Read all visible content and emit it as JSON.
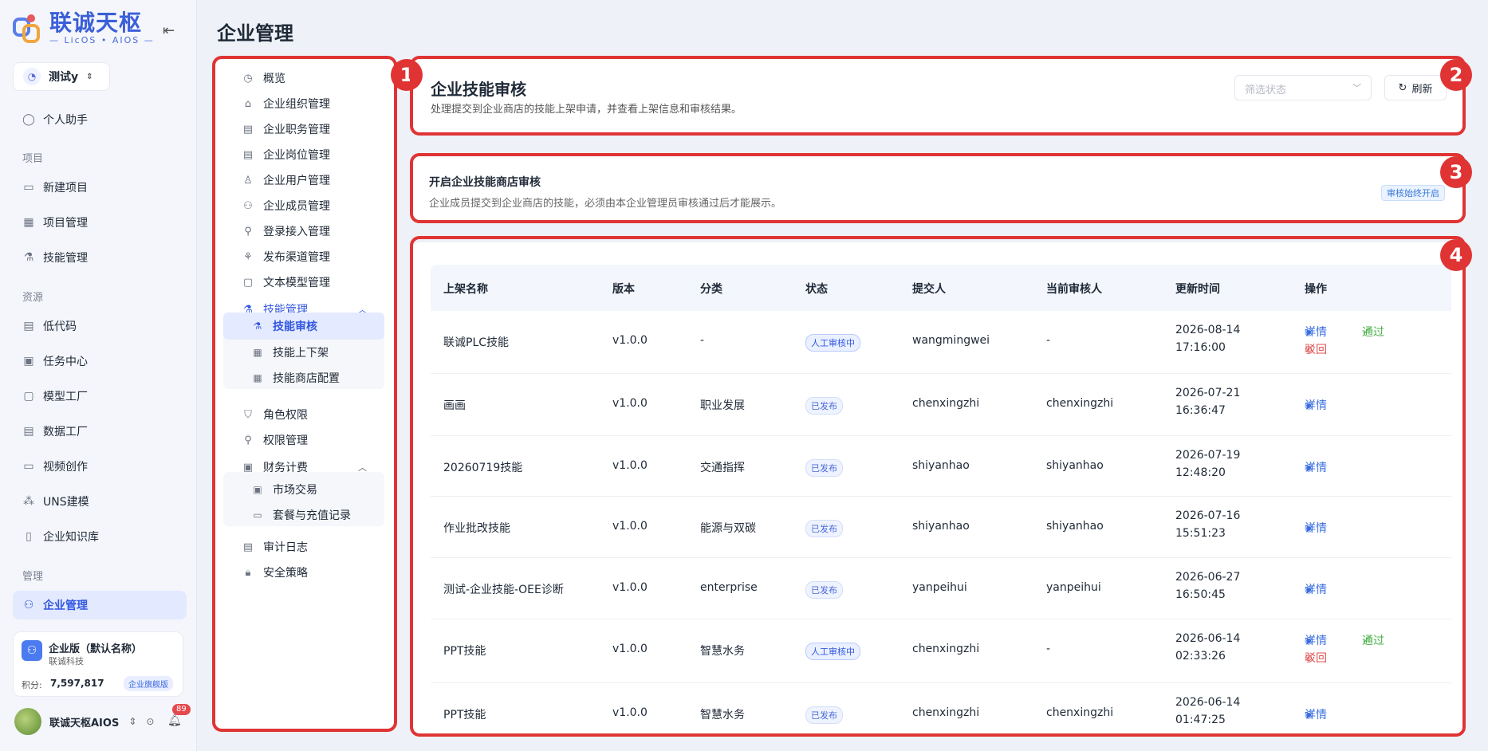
{
  "brand": {
    "title": "联诚天枢",
    "subtitle": "— LicOS • AIOS —"
  },
  "workspace": {
    "name": "测试y"
  },
  "app_nav": {
    "assistant": "个人助手",
    "group_project": "项目",
    "new_project": "新建项目",
    "project_mgmt": "项目管理",
    "skill_mgmt": "技能管理",
    "group_resource": "资源",
    "low_code": "低代码",
    "task_center": "任务中心",
    "model_factory": "模型工厂",
    "data_factory": "数据工厂",
    "video_create": "视频创作",
    "uns": "UNS建模",
    "knowledge": "企业知识库",
    "group_manage": "管理",
    "enterprise_mgmt": "企业管理"
  },
  "org_card": {
    "name": "企业版（默认名称）",
    "company": "联诚科技",
    "points_label": "积分:",
    "points_value": "7,597,817",
    "plan_badge": "企业旗舰版"
  },
  "user": {
    "name": "联诚天枢AIOS",
    "notifications": "89"
  },
  "page_title": "企业管理",
  "sub_menu": {
    "overview": "概览",
    "org": "企业组织管理",
    "duty": "企业职务管理",
    "post": "企业岗位管理",
    "user": "企业用户管理",
    "member": "企业成员管理",
    "login": "登录接入管理",
    "channel": "发布渠道管理",
    "text_model": "文本模型管理",
    "skill": "技能管理",
    "skill_review": "技能审核",
    "skill_shelf": "技能上下架",
    "skill_store": "技能商店配置",
    "role": "角色权限",
    "perm": "权限管理",
    "finance": "财务计费",
    "market": "市场交易",
    "package": "套餐与充值记录",
    "audit": "审计日志",
    "security": "安全策略"
  },
  "header_card": {
    "title": "企业技能审核",
    "desc": "处理提交到企业商店的技能上架申请，并查看上架信息和审核结果。",
    "filter_placeholder": "筛选状态",
    "refresh": "刷新"
  },
  "setting_card": {
    "title": "开启企业技能商店审核",
    "desc": "企业成员提交到企业商店的技能，必须由本企业管理员审核通过后才能展示。",
    "badge": "审核始终开启"
  },
  "table": {
    "columns": [
      "上架名称",
      "版本",
      "分类",
      "状态",
      "提交人",
      "当前审核人",
      "更新时间",
      "操作"
    ],
    "rows": [
      {
        "name": "联诚PLC技能",
        "version": "v1.0.0",
        "category": "-",
        "status": "人工审核中",
        "status_type": "review",
        "submitter": "wangmingwei",
        "reviewer": "-",
        "date": "2026-08-14",
        "time": "17:16:00",
        "actions": [
          "详情",
          "通过",
          "驳回"
        ]
      },
      {
        "name": "画画",
        "version": "v1.0.0",
        "category": "职业发展",
        "status": "已发布",
        "status_type": "pub",
        "submitter": "chenxingzhi",
        "reviewer": "chenxingzhi",
        "date": "2026-07-21",
        "time": "16:36:47",
        "actions": [
          "详情"
        ]
      },
      {
        "name": "20260719技能",
        "version": "v1.0.0",
        "category": "交通指挥",
        "status": "已发布",
        "status_type": "pub",
        "submitter": "shiyanhao",
        "reviewer": "shiyanhao",
        "date": "2026-07-19",
        "time": "12:48:20",
        "actions": [
          "详情"
        ]
      },
      {
        "name": "作业批改技能",
        "version": "v1.0.0",
        "category": "能源与双碳",
        "status": "已发布",
        "status_type": "pub",
        "submitter": "shiyanhao",
        "reviewer": "shiyanhao",
        "date": "2026-07-16",
        "time": "15:51:23",
        "actions": [
          "详情"
        ]
      },
      {
        "name": "测试-企业技能-OEE诊断",
        "version": "v1.0.0",
        "category": "enterprise",
        "status": "已发布",
        "status_type": "pub",
        "submitter": "yanpeihui",
        "reviewer": "yanpeihui",
        "date": "2026-06-27",
        "time": "16:50:45",
        "actions": [
          "详情"
        ]
      },
      {
        "name": "PPT技能",
        "version": "v1.0.0",
        "category": "智慧水务",
        "status": "人工审核中",
        "status_type": "review",
        "submitter": "chenxingzhi",
        "reviewer": "-",
        "date": "2026-06-14",
        "time": "02:33:26",
        "actions": [
          "详情",
          "通过",
          "驳回"
        ]
      },
      {
        "name": "PPT技能",
        "version": "v1.0.0",
        "category": "智慧水务",
        "status": "已发布",
        "status_type": "pub",
        "submitter": "chenxingzhi",
        "reviewer": "chenxingzhi",
        "date": "2026-06-14",
        "time": "01:47:25",
        "actions": [
          "详情"
        ]
      }
    ]
  },
  "annotations": [
    "1",
    "2",
    "3",
    "4"
  ],
  "colors": {
    "accent": "#3257e0",
    "annotation": "#e03434",
    "pass": "#49b048",
    "reject": "#e05050"
  }
}
